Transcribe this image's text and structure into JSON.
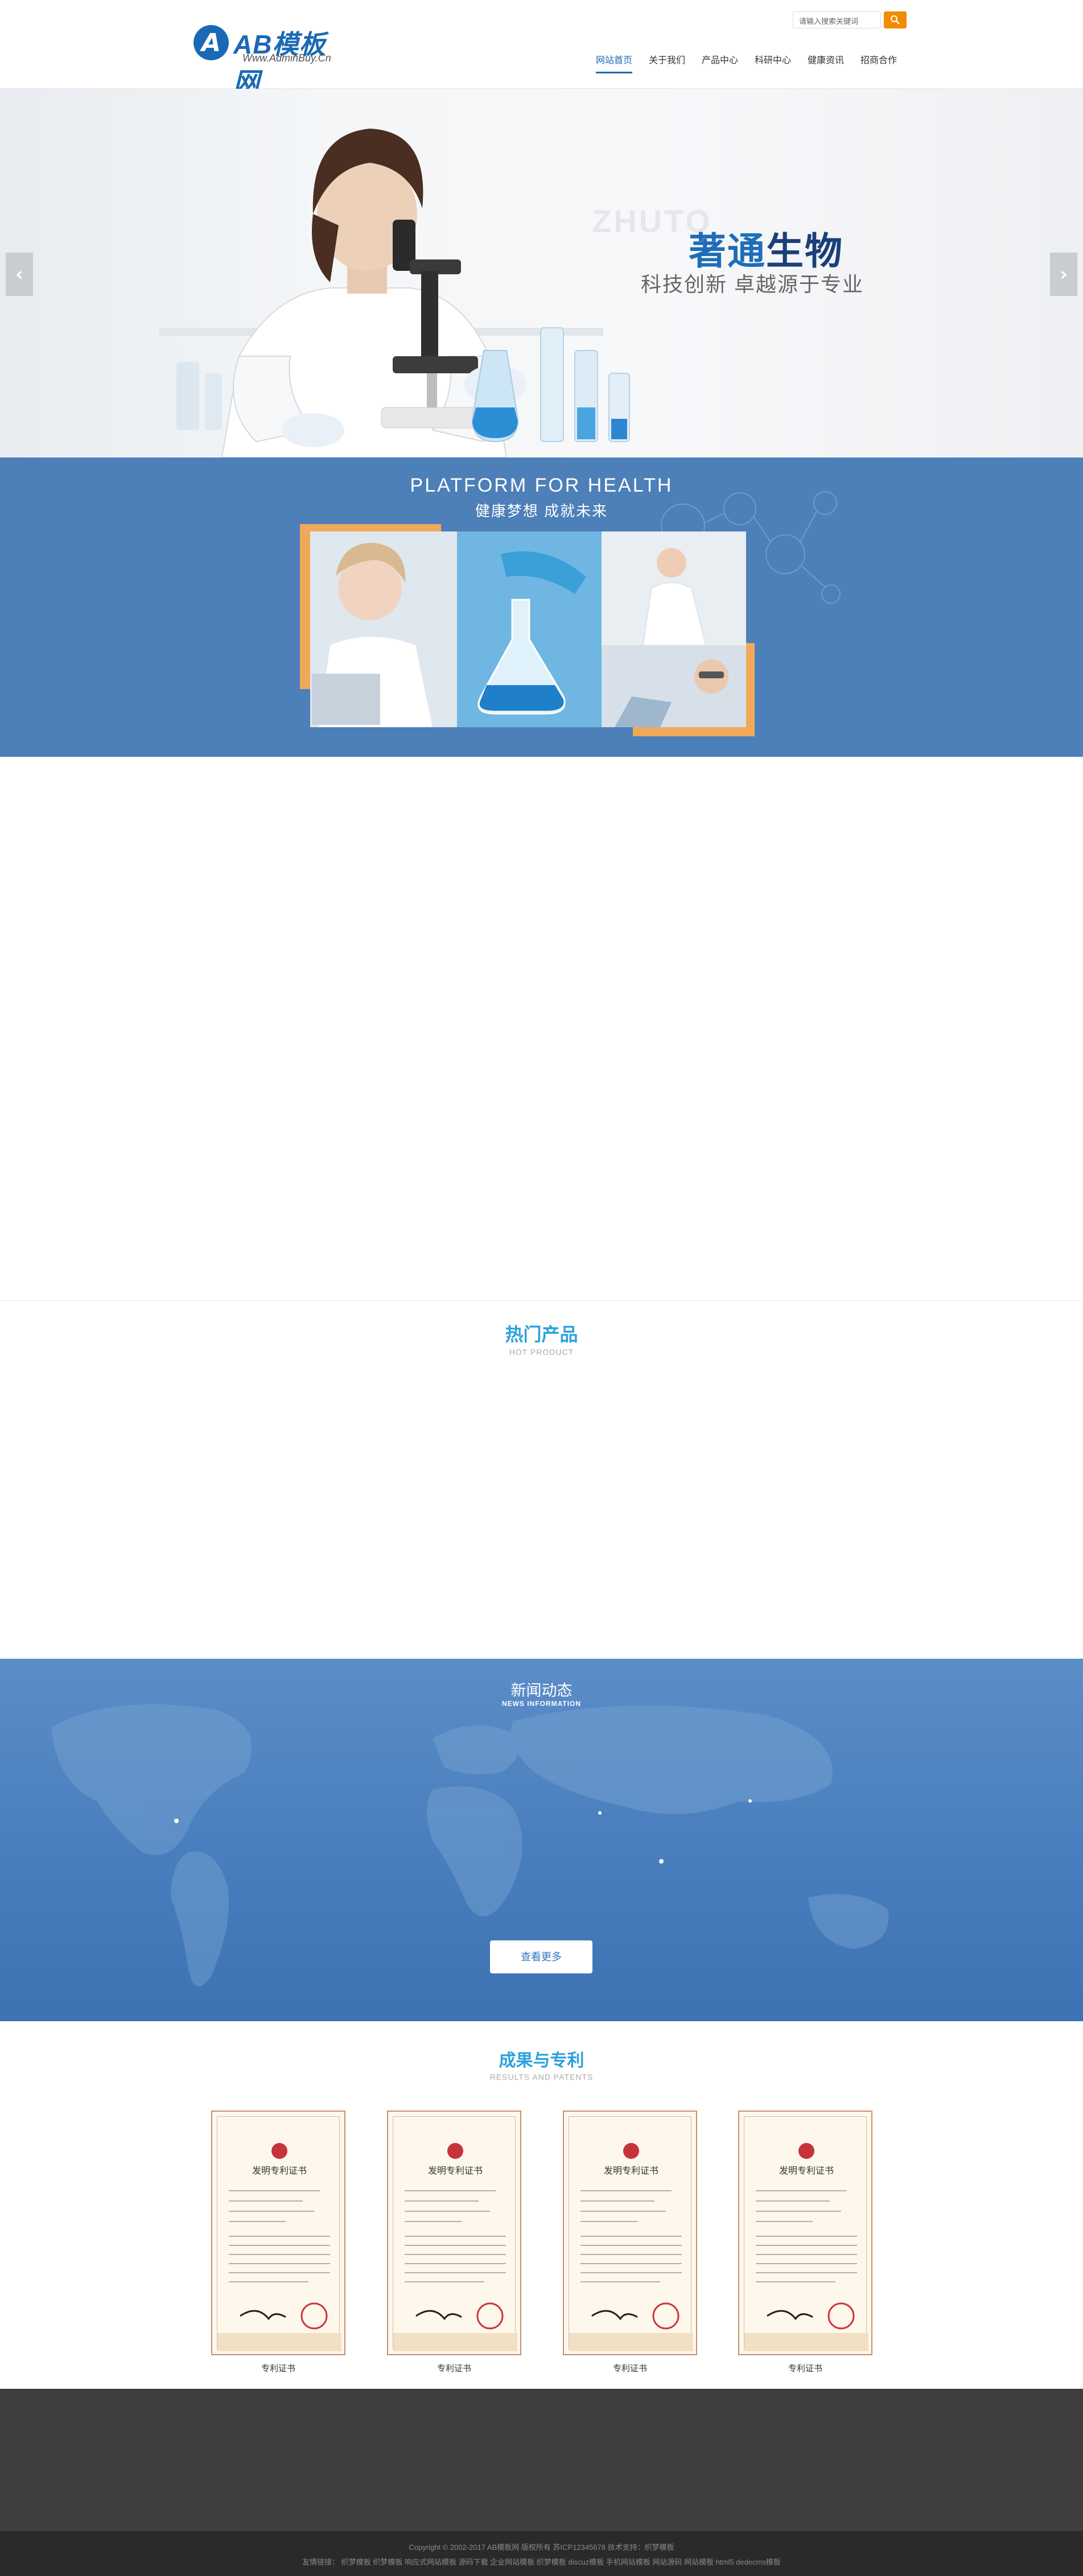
{
  "header": {
    "logo_brand": "AB模板网",
    "logo_url": "Www.AdminBuy.Cn",
    "search_placeholder": "请输入搜索关键词",
    "nav": [
      {
        "label": "网站首页",
        "active": true
      },
      {
        "label": "关于我们",
        "active": false
      },
      {
        "label": "产品中心",
        "active": false
      },
      {
        "label": "科研中心",
        "active": false
      },
      {
        "label": "健康资讯",
        "active": false
      },
      {
        "label": "招商合作",
        "active": false
      }
    ]
  },
  "hero": {
    "ghost_text": "ZHUTO",
    "title_part1": "著通",
    "title_part2": "生物",
    "subtitle": "科技创新  卓越源于专业"
  },
  "platform": {
    "title": "PLATFORM  FOR  HEALTH",
    "subtitle": "健康梦想  成就未来"
  },
  "hot_products": {
    "title": "热门产品",
    "subtitle": "HOT PRODUCT"
  },
  "news": {
    "title": "新闻动态",
    "subtitle": "NEWS INFORMATION",
    "more_label": "查看更多"
  },
  "patents": {
    "title": "成果与专利",
    "subtitle": "RESULTS AND PATENTS",
    "items": [
      {
        "label": "专利证书",
        "cert_heading": "发明专利证书"
      },
      {
        "label": "专利证书",
        "cert_heading": "发明专利证书"
      },
      {
        "label": "专利证书",
        "cert_heading": "发明专利证书"
      },
      {
        "label": "专利证书",
        "cert_heading": "发明专利证书"
      }
    ]
  },
  "footer": {
    "copyright": "Copyright © 2002-2017 AB模板网 版权所有  苏ICP12345678  技术支持：织梦模板",
    "links": "友情链接：  织梦模板  织梦模板  响应式网站模板  源码下载  企业网站模板  织梦模板  discuz模板  手机网站模板  网站源码  网站模板  html5  dedecms模板"
  },
  "colors": {
    "brand_blue": "#1a69b5",
    "accent_orange": "#f08c00",
    "section_title_blue": "#2aa1db",
    "platform_bg": "#4d7fb8",
    "footer_dark": "#3e3e3e"
  }
}
